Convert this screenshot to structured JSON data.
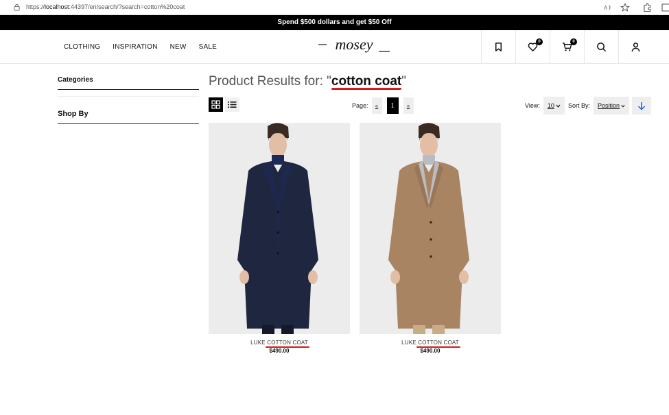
{
  "browser": {
    "url_prefix": "https://",
    "url_host": "localhost",
    "url_rest": ":44397/en/search/?search=cotton%20coat"
  },
  "promo": {
    "text": "Spend $500 dollars and get $50 Off"
  },
  "nav": {
    "items": [
      "CLOTHING",
      "INSPIRATION",
      "NEW",
      "SALE"
    ]
  },
  "brand": {
    "logo_text": "mosey"
  },
  "header_icons": {
    "wishlist_count": "0",
    "cart_count": "0"
  },
  "sidebar": {
    "categories_title": "Categories",
    "shopby_title": "Shop By"
  },
  "results": {
    "title_prefix": "Product Results for: \"",
    "query": "cotton coat",
    "title_suffix": "\""
  },
  "toolbar": {
    "page_label": "Page:",
    "prev": "«",
    "current_page": "1",
    "next": "»",
    "view_label": "View:",
    "view_value": "10",
    "sort_label": "Sort By:",
    "sort_value": "Position"
  },
  "products": [
    {
      "name_prefix": "LUKE ",
      "name_highlight": "COTTON COAT",
      "price": "$490.00",
      "coat_color": "#1f2740",
      "inner_color": "#1c2a55"
    },
    {
      "name_prefix": "LUKE ",
      "name_highlight": "COTTON COAT",
      "price": "$490.00",
      "coat_color": "#a98463",
      "inner_color": "#b9bdc2"
    }
  ],
  "colors": {
    "accent_underline": "#d31a1a",
    "sort_arrow": "#1a5fd0"
  }
}
